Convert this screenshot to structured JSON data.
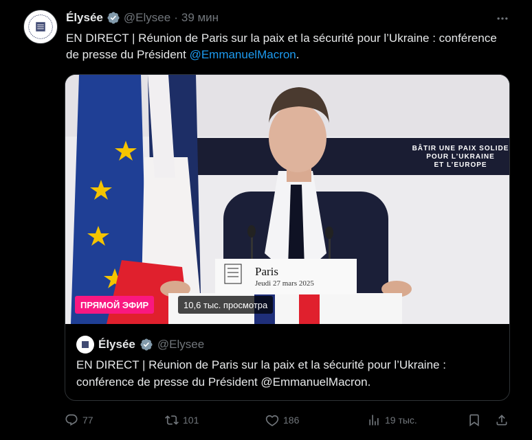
{
  "author": {
    "name": "Élysée",
    "handle": "@Elysee",
    "separator": "·",
    "time": "39 мин"
  },
  "tweet": {
    "text_before": "EN DIRECT | Réunion de Paris sur la paix et la sécurité pour l’Ukraine : conférence de presse du Président ",
    "mention": "@EmmanuelMacron",
    "text_after": "."
  },
  "media": {
    "backdrop_line1": "BÂTIR UNE PAIX SOLIDE",
    "backdrop_line2": "POUR L’UKRAINE",
    "backdrop_line3": "ET L’EUROPE",
    "podium_city": "Paris",
    "podium_date": "Jeudi 27 mars 2025",
    "live_badge": "ПРЯМОЙ ЭФИР",
    "views": "10,6 тыс. просмотра"
  },
  "quoted": {
    "name": "Élysée",
    "handle": "@Elysee",
    "text": "EN DIRECT | Réunion de Paris sur la paix et la sécurité pour l’Ukraine : conférence de presse du Président @EmmanuelMacron."
  },
  "actions": {
    "replies": "77",
    "reposts": "101",
    "likes": "186",
    "views": "19 тыс."
  },
  "colors": {
    "background": "#000000",
    "text": "#e7e9ea",
    "muted": "#71767b",
    "link": "#1d9bf0",
    "verified": "#829aab",
    "live": "#f91880"
  }
}
